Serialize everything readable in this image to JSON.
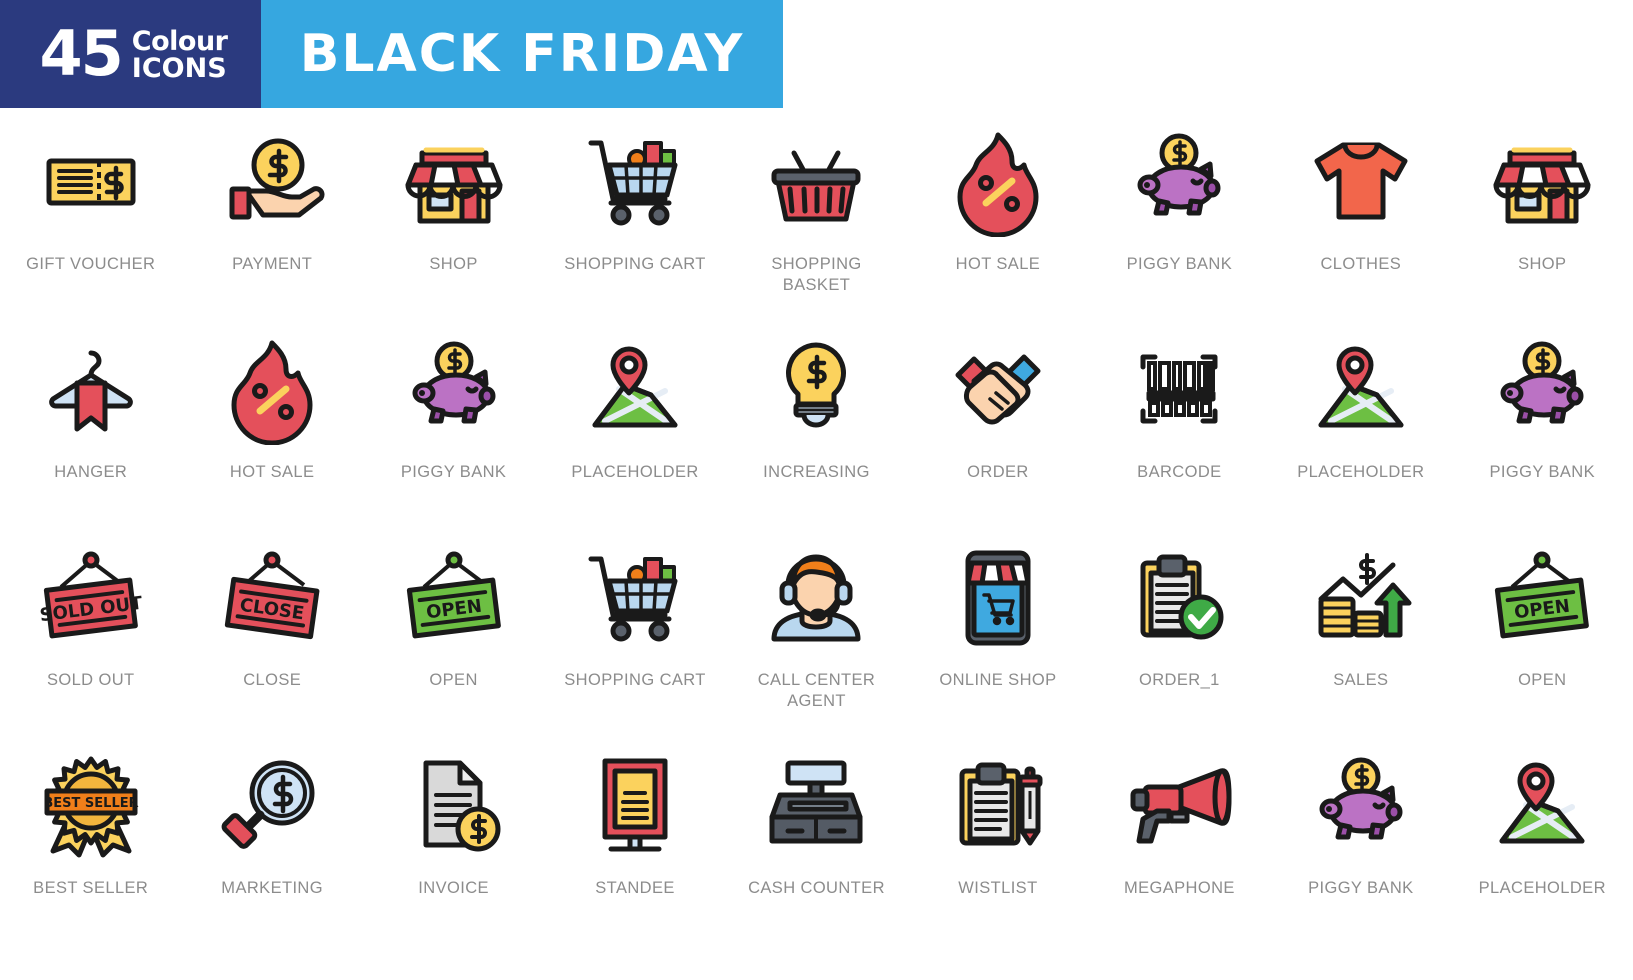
{
  "header": {
    "count": "45",
    "colour_word": "Colour",
    "icons_word": "ICONS",
    "title": "BLACK FRIDAY",
    "left_bg": "#2b3a7f",
    "right_bg": "#36a7e0",
    "text_color": "#ffffff"
  },
  "palette": {
    "outline": "#1a1a1a",
    "yellow": "#fbd25d",
    "gold": "#f2b53d",
    "red": "#e4505b",
    "red_dark": "#d63c4a",
    "coral": "#f2664b",
    "purple": "#bb72c4",
    "purple_dark": "#9b4fa8",
    "green": "#6dbf43",
    "green_dark": "#3faa46",
    "blue": "#3fa9e0",
    "blue_light": "#b9d7ef",
    "blue_pale": "#cfe3f5",
    "gray": "#d9d9d9",
    "gray_dark": "#5a616b",
    "skin": "#fbd3ae",
    "orange": "#f07f1a",
    "label": "#8c8c8c",
    "white": "#ffffff"
  },
  "labels": {
    "caption_font_size": "16.5px"
  },
  "icons": [
    {
      "id": "gift-voucher",
      "label": "GIFT VOUCHER",
      "row": 1,
      "col": 1
    },
    {
      "id": "payment",
      "label": "PAYMENT",
      "row": 1,
      "col": 2
    },
    {
      "id": "shop",
      "label": "SHOP",
      "row": 1,
      "col": 3
    },
    {
      "id": "shopping-cart",
      "label": "SHOPPING CART",
      "row": 1,
      "col": 4
    },
    {
      "id": "shopping-basket",
      "label": "SHOPPING BASKET",
      "row": 1,
      "col": 5
    },
    {
      "id": "hot-sale",
      "label": "HOT SALE",
      "row": 1,
      "col": 6
    },
    {
      "id": "piggy-bank",
      "label": "PIGGY BANK",
      "row": 1,
      "col": 7
    },
    {
      "id": "clothes",
      "label": "CLOTHES",
      "row": 1,
      "col": 8
    },
    {
      "id": "shop-2",
      "label": "SHOP",
      "row": 1,
      "col": 9
    },
    {
      "id": "hanger",
      "label": "HANGER",
      "row": 2,
      "col": 1
    },
    {
      "id": "hot-sale-2",
      "label": "HOT SALE",
      "row": 2,
      "col": 2
    },
    {
      "id": "piggy-bank-2",
      "label": "PIGGY BANK",
      "row": 2,
      "col": 3
    },
    {
      "id": "placeholder",
      "label": "PLACEHOLDER",
      "row": 2,
      "col": 4
    },
    {
      "id": "increasing",
      "label": "INCREASING",
      "row": 2,
      "col": 5
    },
    {
      "id": "order",
      "label": "ORDER",
      "row": 2,
      "col": 6
    },
    {
      "id": "barcode",
      "label": "BARCODE",
      "row": 2,
      "col": 7
    },
    {
      "id": "placeholder-2",
      "label": "PLACEHOLDER",
      "row": 2,
      "col": 8
    },
    {
      "id": "piggy-bank-3",
      "label": "PIGGY BANK",
      "row": 2,
      "col": 9
    },
    {
      "id": "sold-out",
      "label": "SOLD OUT",
      "row": 3,
      "col": 1,
      "sign_text": "SOLD OUT"
    },
    {
      "id": "close",
      "label": "CLOSE",
      "row": 3,
      "col": 2,
      "sign_text": "CLOSE"
    },
    {
      "id": "open",
      "label": "OPEN",
      "row": 3,
      "col": 3,
      "sign_text": "OPEN"
    },
    {
      "id": "shopping-cart-2",
      "label": "SHOPPING CART",
      "row": 3,
      "col": 4
    },
    {
      "id": "call-center-agent",
      "label": "CALL CENTER AGENT",
      "row": 3,
      "col": 5
    },
    {
      "id": "online-shop",
      "label": "ONLINE SHOP",
      "row": 3,
      "col": 6
    },
    {
      "id": "order-1",
      "label": "ORDER_1",
      "row": 3,
      "col": 7
    },
    {
      "id": "sales",
      "label": "SALES",
      "row": 3,
      "col": 8
    },
    {
      "id": "open-2",
      "label": "OPEN",
      "row": 3,
      "col": 9,
      "sign_text": "OPEN"
    },
    {
      "id": "best-seller",
      "label": "BEST SELLER",
      "row": 4,
      "col": 1,
      "badge_text": "BEST SELLER"
    },
    {
      "id": "marketing",
      "label": "MARKETING",
      "row": 4,
      "col": 2
    },
    {
      "id": "invoice",
      "label": "INVOICE",
      "row": 4,
      "col": 3
    },
    {
      "id": "standee",
      "label": "STANDEE",
      "row": 4,
      "col": 4
    },
    {
      "id": "cash-counter",
      "label": "CASH COUNTER",
      "row": 4,
      "col": 5
    },
    {
      "id": "wistlist",
      "label": "WISTLIST",
      "row": 4,
      "col": 6
    },
    {
      "id": "megaphone",
      "label": "MEGAPHONE",
      "row": 4,
      "col": 7
    },
    {
      "id": "piggy-bank-4",
      "label": "PIGGY BANK",
      "row": 4,
      "col": 8
    },
    {
      "id": "placeholder-3",
      "label": "PLACEHOLDER",
      "row": 4,
      "col": 9
    }
  ]
}
